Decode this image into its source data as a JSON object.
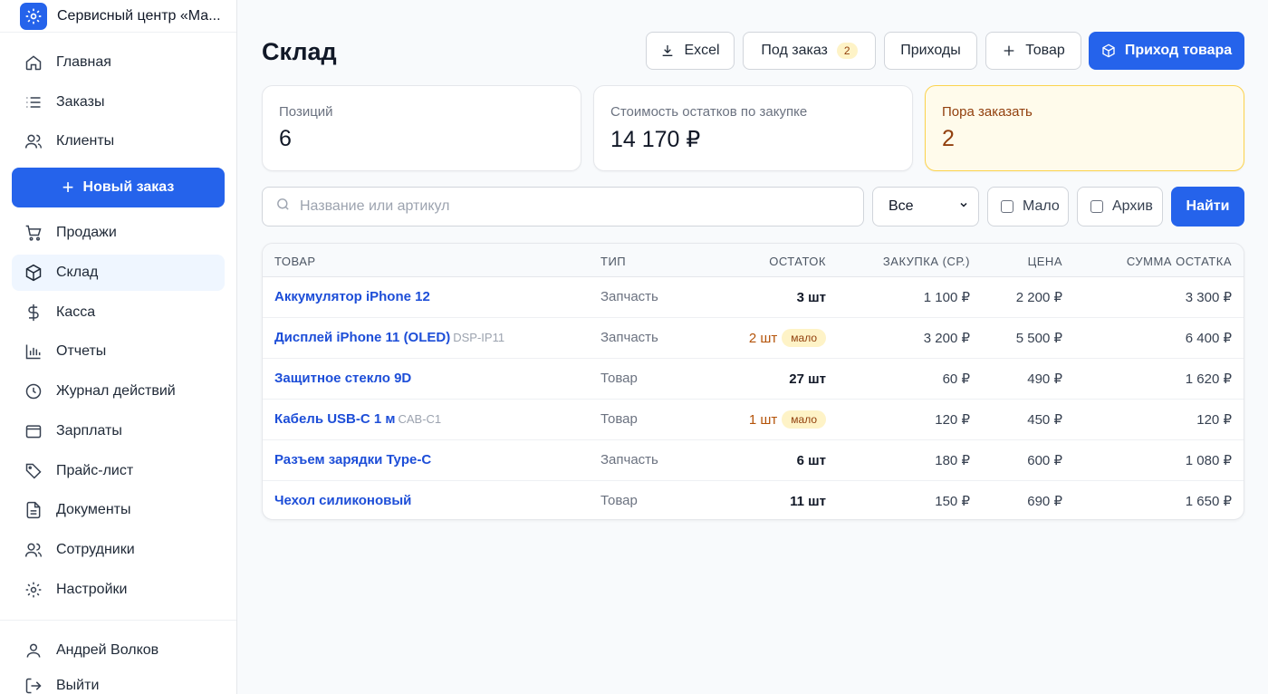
{
  "brand": {
    "title": "Сервисный центр «Ма..."
  },
  "sidebar": {
    "items_top": [
      {
        "label": "Главная",
        "icon": "home-icon"
      },
      {
        "label": "Заказы",
        "icon": "list-icon"
      },
      {
        "label": "Клиенты",
        "icon": "users-icon"
      }
    ],
    "new_order_label": "Новый заказ",
    "items": [
      {
        "label": "Продажи",
        "icon": "cart-icon"
      },
      {
        "label": "Склад",
        "icon": "box-icon",
        "active": true
      },
      {
        "label": "Касса",
        "icon": "dollar-icon"
      },
      {
        "label": "Отчеты",
        "icon": "bar-chart-icon"
      },
      {
        "label": "Журнал действий",
        "icon": "clock-icon"
      },
      {
        "label": "Зарплаты",
        "icon": "wallet-icon"
      },
      {
        "label": "Прайс-лист",
        "icon": "tag-icon"
      },
      {
        "label": "Документы",
        "icon": "document-icon"
      },
      {
        "label": "Сотрудники",
        "icon": "team-icon"
      },
      {
        "label": "Настройки",
        "icon": "gear-icon"
      }
    ],
    "user_name": "Андрей Волков",
    "logout_label": "Выйти"
  },
  "header": {
    "title": "Склад",
    "excel_label": "Excel",
    "preorder_label": "Под заказ",
    "preorder_count": "2",
    "arrivals_label": "Приходы",
    "add_product_label": "Товар",
    "goods_receipt_label": "Приход товара"
  },
  "stats": {
    "positions_label": "Позиций",
    "positions_value": "6",
    "stock_cost_label": "Стоимость остатков по закупке",
    "stock_cost_value": "14 170 ₽",
    "reorder_label": "Пора заказать",
    "reorder_value": "2"
  },
  "filters": {
    "search_placeholder": "Название или артикул",
    "type_selected": "Все",
    "low_label": "Мало",
    "archive_label": "Архив",
    "find_label": "Найти"
  },
  "table": {
    "headers": {
      "product": "ТОВАР",
      "type": "ТИП",
      "stock": "ОСТАТОК",
      "purchase": "ЗАКУПКА (СР.)",
      "price": "ЦЕНА",
      "sum": "СУММА ОСТАТКА"
    },
    "low_badge": "мало",
    "rows": [
      {
        "name": "Аккумулятор iPhone 12",
        "sku": "",
        "type": "Запчасть",
        "stock": "3 шт",
        "low": false,
        "purchase": "1 100 ₽",
        "price": "2 200 ₽",
        "sum": "3 300 ₽"
      },
      {
        "name": "Дисплей iPhone 11 (OLED)",
        "sku": "DSP-IP11",
        "type": "Запчасть",
        "stock": "2 шт",
        "low": true,
        "purchase": "3 200 ₽",
        "price": "5 500 ₽",
        "sum": "6 400 ₽"
      },
      {
        "name": "Защитное стекло 9D",
        "sku": "",
        "type": "Товар",
        "stock": "27 шт",
        "low": false,
        "purchase": "60 ₽",
        "price": "490 ₽",
        "sum": "1 620 ₽"
      },
      {
        "name": "Кабель USB-C 1 м",
        "sku": "CAB-C1",
        "type": "Товар",
        "stock": "1 шт",
        "low": true,
        "purchase": "120 ₽",
        "price": "450 ₽",
        "sum": "120 ₽"
      },
      {
        "name": "Разъем зарядки Type-C",
        "sku": "",
        "type": "Запчасть",
        "stock": "6 шт",
        "low": false,
        "purchase": "180 ₽",
        "price": "600 ₽",
        "sum": "1 080 ₽"
      },
      {
        "name": "Чехол силиконовый",
        "sku": "",
        "type": "Товар",
        "stock": "11 шт",
        "low": false,
        "purchase": "150 ₽",
        "price": "690 ₽",
        "sum": "1 650 ₽"
      }
    ]
  },
  "colors": {
    "accent": "#2563eb",
    "warning_bg": "#fffbeb",
    "warning_text": "#92400e"
  }
}
